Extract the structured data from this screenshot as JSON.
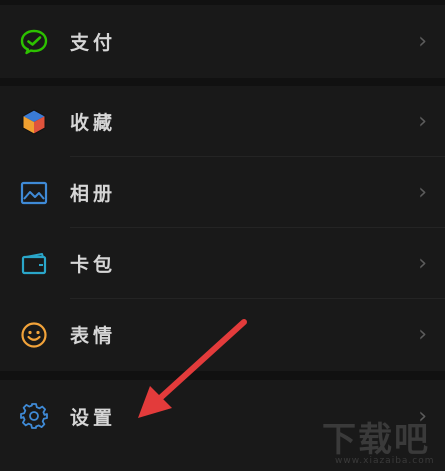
{
  "menu_groups": [
    {
      "items": [
        {
          "label": "支付",
          "icon": "wechat-pay-icon",
          "color": "#2dc100"
        }
      ]
    },
    {
      "items": [
        {
          "label": "收藏",
          "icon": "favorites-cube-icon"
        },
        {
          "label": "相册",
          "icon": "album-image-icon"
        },
        {
          "label": "卡包",
          "icon": "card-wallet-icon"
        },
        {
          "label": "表情",
          "icon": "sticker-smiley-icon"
        }
      ]
    },
    {
      "items": [
        {
          "label": "设置",
          "icon": "settings-gear-icon"
        }
      ]
    }
  ],
  "chevron_glyph": "›",
  "annotation_arrow_color": "#e33b3b",
  "watermark": {
    "main": "下载吧",
    "sub": "www.xiazaiba.com"
  }
}
